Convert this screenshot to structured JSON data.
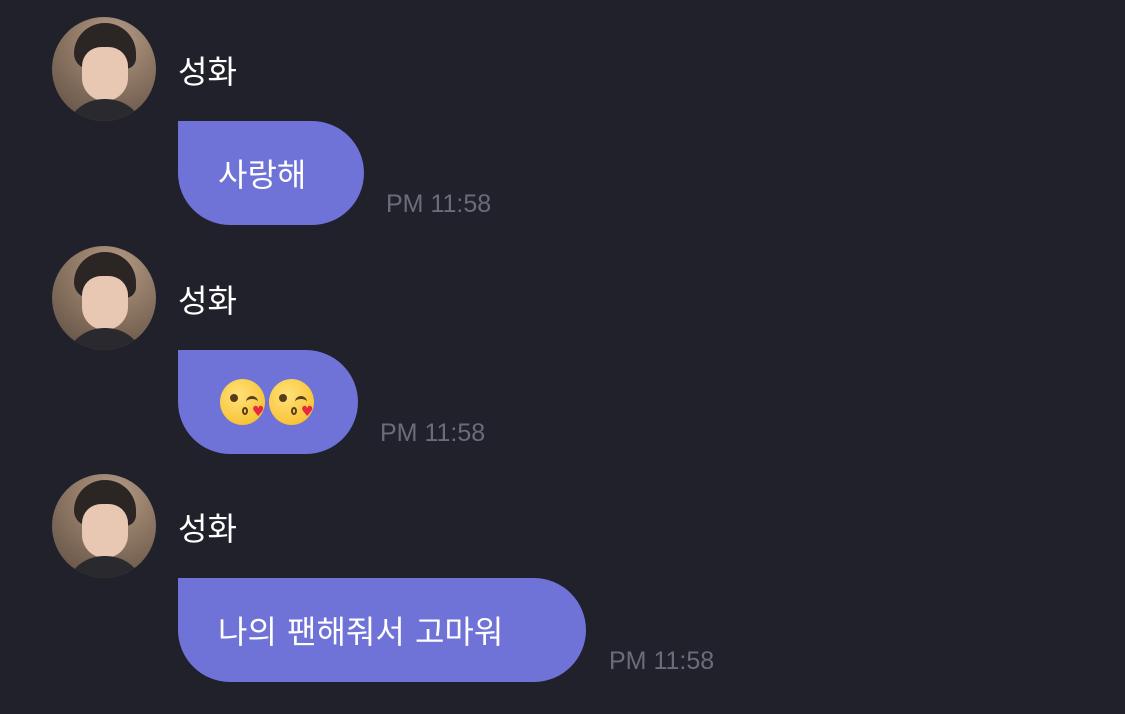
{
  "messages": [
    {
      "sender": "성화",
      "text": "사랑해",
      "time": "PM 11:58"
    },
    {
      "sender": "성화",
      "emojis": [
        "kissing-face-emoji",
        "kissing-face-emoji"
      ],
      "time": "PM 11:58"
    },
    {
      "sender": "성화",
      "text": "나의 팬해줘서 고마워",
      "time": "PM 11:58"
    }
  ],
  "colors": {
    "background": "#21212b",
    "bubble": "#6f72d6",
    "timestamp": "#6c6c78",
    "text": "#ffffff"
  }
}
